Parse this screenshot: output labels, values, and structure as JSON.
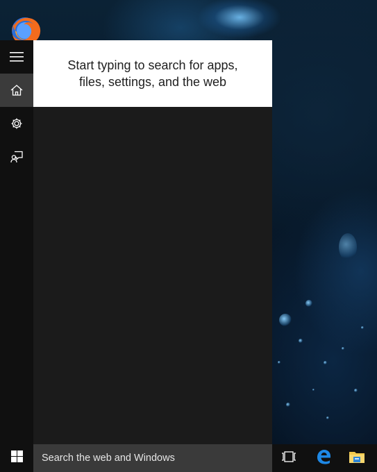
{
  "desktop": {
    "icons": [
      {
        "name": "firefox-icon"
      }
    ]
  },
  "start_panel": {
    "hint_text": "Start typing to search for apps, files, settings, and the web",
    "rail": [
      {
        "icon": "hamburger-menu-icon",
        "active": false
      },
      {
        "icon": "home-icon",
        "active": true
      },
      {
        "icon": "gear-icon",
        "active": false
      },
      {
        "icon": "feedback-icon",
        "active": false
      }
    ]
  },
  "taskbar": {
    "start_icon": "windows-logo-icon",
    "search": {
      "placeholder": "Search the web and Windows",
      "value": ""
    },
    "apps": [
      {
        "icon": "task-view-icon"
      },
      {
        "icon": "edge-icon"
      },
      {
        "icon": "file-explorer-icon"
      }
    ]
  },
  "colors": {
    "panel_bg": "#1b1b1b",
    "rail_bg": "#101010",
    "rail_active": "#3b3b3b",
    "search_bg": "#3a3a3a",
    "taskbar_bg": "#101010",
    "edge_blue": "#1e88e5",
    "folder_yellow": "#f2c94c"
  }
}
